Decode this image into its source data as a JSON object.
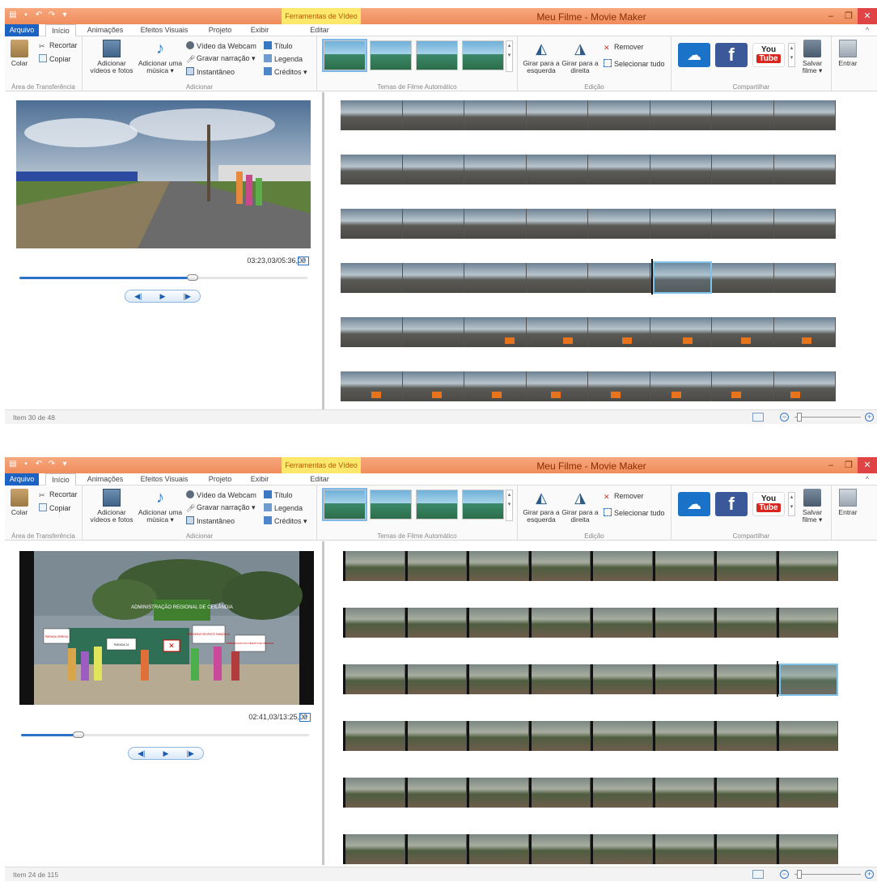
{
  "tabs": [
    "Arquivo",
    "Início",
    "Animações",
    "Efeitos Visuais",
    "Projeto",
    "Exibir",
    "Editar"
  ],
  "contextual_tab": "Ferramentas de Vídeo",
  "ribbon": {
    "colar": "Colar",
    "recortar": "Recortar",
    "copiar": "Copiar",
    "area_transferencia": "Área de Transferência",
    "adicionar_videos": "Adicionar vídeos e fotos",
    "adicionar_musica": "Adicionar uma música ▾",
    "video_webcam": "Vídeo da Webcam",
    "gravar_narracao": "Gravar narração ▾",
    "instantaneo": "Instantâneo",
    "titulo": "Título",
    "legenda": "Legenda",
    "creditos": "Créditos ▾",
    "adicionar": "Adicionar",
    "temas": "Temas de Filme Automático",
    "girar_esquerda": "Girar para a esquerda",
    "girar_direita": "Girar para a direita",
    "remover": "Remover",
    "selecionar_tudo": "Selecionar tudo",
    "edicao": "Edição",
    "youtube_top": "You",
    "youtube_bottom": "Tube",
    "salvar_filme": "Salvar filme ▾",
    "compartilhar": "Compartilhar",
    "entrar": "Entrar"
  },
  "windows": [
    {
      "title": "Meu Filme - Movie Maker",
      "timecode": "03:23,03/05:36,00",
      "progress": 0.6,
      "status": "Item 30 de 48"
    },
    {
      "title": "Meu Filme - Movie Maker",
      "timecode": "02:41,03/13:25,00",
      "progress": 0.2,
      "status": "Item 24 de 115"
    }
  ],
  "preview2_signs": {
    "banner": "ADMINISTRAÇÃO REGIONAL DE CEILÂNDIA",
    "sign1": "PARADA OBRIGA",
    "sign2": "PARADA 24",
    "sign3": "PRESERVE RESPEITE PARADA 24",
    "sign4": "OBSERVAÇÃO DO DIREITO DE OBRIGAR"
  },
  "colors": {
    "titlebar": "#f08c5c",
    "file_tab": "#1c63c4",
    "contextual": "#fde86b",
    "accent": "#2b72c8"
  }
}
